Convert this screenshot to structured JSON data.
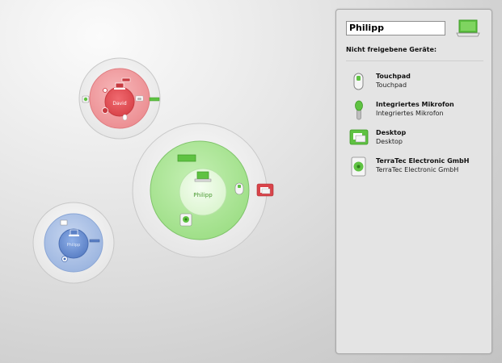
{
  "users": {
    "david": {
      "name": "David",
      "color": "#e9898c"
    },
    "philipp": {
      "name": "Philipp",
      "color": "#8fd47e"
    },
    "third": {
      "name": "Philipp",
      "color": "#8aa8d8"
    }
  },
  "panel": {
    "name_value": "Philipp",
    "section_title": "Nicht freigebene Geräte:",
    "devices": [
      {
        "name": "Touchpad",
        "sub": "Touchpad",
        "icon": "touchpad-icon"
      },
      {
        "name": "Integriertes Mikrofon",
        "sub": "Integriertes Mikrofon",
        "icon": "microphone-icon"
      },
      {
        "name": "Desktop",
        "sub": "Desktop",
        "icon": "desktop-icon"
      },
      {
        "name": "TerraTec Electronic GmbH",
        "sub": "TerraTec Electronic GmbH",
        "icon": "speaker-icon"
      }
    ]
  },
  "colors": {
    "accent_green": "#5fc242",
    "accent_red": "#d9444a",
    "accent_blue": "#5b80c6"
  }
}
